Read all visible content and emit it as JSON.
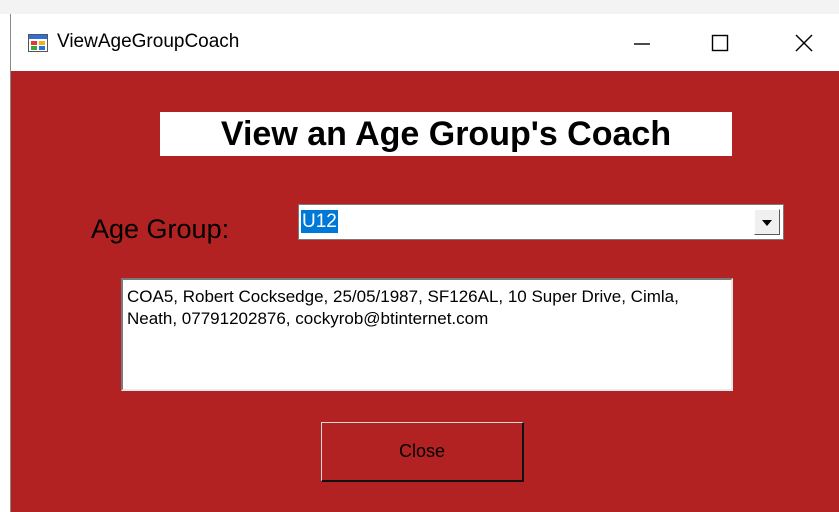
{
  "window": {
    "title": "ViewAgeGroupCoach",
    "background_color": "#b22222",
    "controls": [
      "minimize-icon",
      "maximize-icon",
      "close-icon"
    ]
  },
  "form": {
    "heading": "View an Age Group's Coach",
    "age_group_label": "Age Group:",
    "age_group_selected": "U12",
    "coach_details": "COA5, Robert Cocksedge, 25/05/1987, SF126AL, 10 Super Drive, Cimla, Neath, 07791202876, cockyrob@btinternet.com",
    "close_label": "Close"
  },
  "colors": {
    "selection_highlight": "#0078d7",
    "heading_background": "#ffffff"
  }
}
